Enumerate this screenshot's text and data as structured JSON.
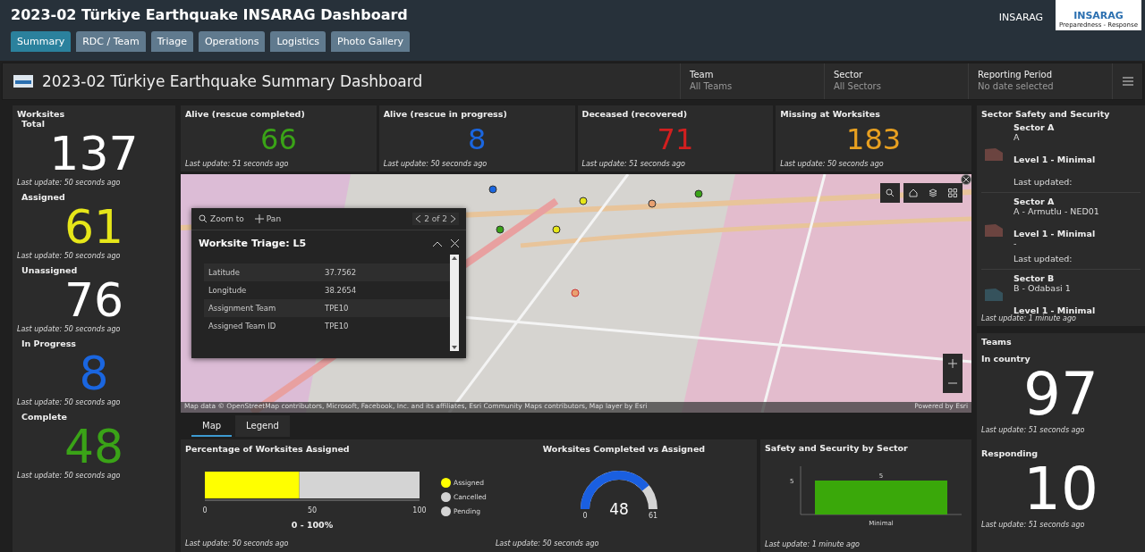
{
  "header": {
    "title": "2023-02 Türkiye Earthquake INSARAG Dashboard",
    "org": "INSARAG",
    "logo": {
      "name": "INSARAG",
      "tagline": "Preparedness - Response"
    }
  },
  "tabs": [
    {
      "label": "Summary",
      "selected": true
    },
    {
      "label": "RDC / Team",
      "selected": false
    },
    {
      "label": "Triage",
      "selected": false
    },
    {
      "label": "Operations",
      "selected": false
    },
    {
      "label": "Logistics",
      "selected": false
    },
    {
      "label": "Photo Gallery",
      "selected": false
    }
  ],
  "dashboard_bar": {
    "title": "2023-02 Türkiye Earthquake Summary Dashboard",
    "filters": [
      {
        "label": "Team",
        "value": "All Teams"
      },
      {
        "label": "Sector",
        "value": "All Sectors"
      },
      {
        "label": "Reporting Period",
        "value": "No date selected"
      }
    ]
  },
  "worksites": {
    "title": "Worksites",
    "items": [
      {
        "label": "Total",
        "value": "137",
        "color": "#ffffff",
        "update": "Last update: 50 seconds ago"
      },
      {
        "label": "Assigned",
        "value": "61",
        "color": "#e6e619",
        "update": "Last update: 50 seconds ago"
      },
      {
        "label": "Unassigned",
        "value": "76",
        "color": "#ffffff",
        "update": "Last update: 50 seconds ago"
      },
      {
        "label": "In Progress",
        "value": "8",
        "color": "#1a66e0",
        "update": "Last update: 50 seconds ago"
      },
      {
        "label": "Complete",
        "value": "48",
        "color": "#3aa317",
        "update": "Last update: 50 seconds ago"
      }
    ]
  },
  "indicators": [
    {
      "title": "Alive (rescue completed)",
      "value": "66",
      "color": "#3aa317",
      "update": "Last update: 51 seconds ago"
    },
    {
      "title": "Alive (rescue in progress)",
      "value": "8",
      "color": "#1a66e0",
      "update": "Last update: 50 seconds ago"
    },
    {
      "title": "Deceased (recovered)",
      "value": "71",
      "color": "#d21f1f",
      "update": "Last update: 51 seconds ago"
    },
    {
      "title": "Missing at Worksites",
      "value": "183",
      "color": "#e8a020",
      "update": "Last update: 50 seconds ago"
    }
  ],
  "map": {
    "popup": {
      "zoom_label": "Zoom to",
      "pan_label": "Pan",
      "pager": "2 of 2",
      "title": "Worksite Triage: L5",
      "rows": [
        {
          "field": "Latitude",
          "value": "37.7562"
        },
        {
          "field": "Longitude",
          "value": "38.2654"
        },
        {
          "field": "Assignment Team",
          "value": "TPE10"
        },
        {
          "field": "Assigned Team ID",
          "value": "TPE10"
        }
      ]
    },
    "attribution": "Map data © OpenStreetMap contributors, Microsoft, Facebook, Inc. and its affiliates, Esri Community Maps contributors, Map layer by Esri",
    "powered_by": "Powered by Esri",
    "view_tabs": [
      {
        "label": "Map",
        "selected": true
      },
      {
        "label": "Legend",
        "selected": false
      }
    ]
  },
  "assigned_chart": {
    "title": "Percentage of Worksites Assigned",
    "update": "Last update: 50 seconds ago",
    "chart_data": {
      "type": "bar",
      "orientation": "horizontal",
      "stacked": true,
      "xlabel": "0 - 100%",
      "series": [
        {
          "name": "Assigned",
          "color": "#ffff00",
          "values": [
            44
          ]
        },
        {
          "name": "Cancelled",
          "color": "#d4d4d4",
          "values": [
            0
          ]
        },
        {
          "name": "Pending",
          "color": "#d4d4d4",
          "values": [
            56
          ]
        }
      ],
      "xlim": [
        0,
        100
      ],
      "xticks": [
        0,
        50,
        100
      ]
    }
  },
  "gauge": {
    "title": "Worksites Completed vs Assigned",
    "value": "48",
    "min": "0",
    "max": "61",
    "update": "Last update: 50 seconds ago"
  },
  "sector_chart": {
    "title": "Safety and Security by Sector",
    "update": "Last update: 1 minute ago",
    "y_tick": "5",
    "bars": [
      {
        "category": "Minimal",
        "label": "5"
      }
    ]
  },
  "sector_safety": {
    "title": "Sector Safety and Security",
    "items": [
      {
        "sector": "Sector A",
        "area": "A",
        "level": "Level 1 - Minimal",
        "color": "#6b4440",
        "updated": "Last updated:"
      },
      {
        "sector": "Sector A",
        "area": "A - Armutlu - NED01",
        "level": "Level 1 - Minimal",
        "color": "#6b4440",
        "note": "-",
        "updated": "Last updated:"
      },
      {
        "sector": "Sector B",
        "area": "B - Odabasi 1",
        "level": "Level 1 - Minimal",
        "color": "#35525c"
      }
    ],
    "update": "Last update: 1 minute ago"
  },
  "teams": {
    "title": "Teams",
    "items": [
      {
        "label": "In country",
        "value": "97",
        "update": "Last update: 51 seconds ago"
      },
      {
        "label": "Responding",
        "value": "10",
        "update": "Last update: 51 seconds ago"
      }
    ]
  }
}
